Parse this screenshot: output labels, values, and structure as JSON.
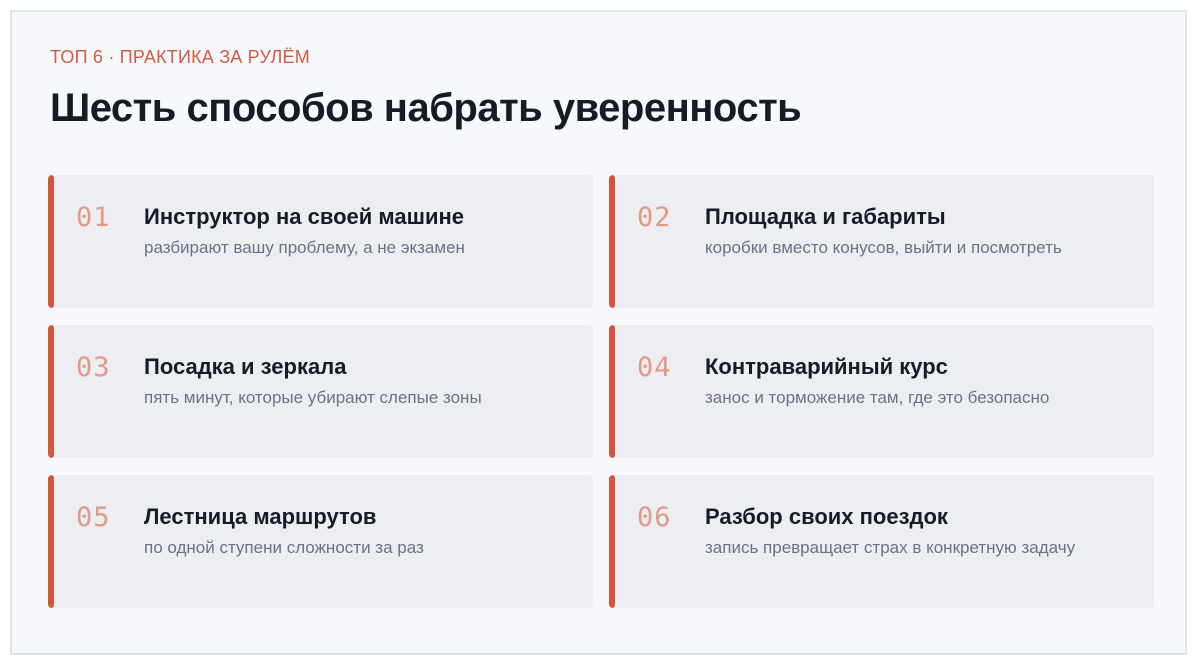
{
  "header": {
    "kicker": "ТОП 6 · ПРАКТИКА ЗА РУЛЁМ",
    "title": "Шесть способов набрать уверенность"
  },
  "colors": {
    "accent": "#d4553a",
    "number": "#e29a86",
    "card_bg": "#eceef2",
    "page_bg": "#f7f8fb",
    "title": "#171b24",
    "subtitle": "#6b7382"
  },
  "items": [
    {
      "number": "01",
      "title": "Инструктор на своей машине",
      "subtitle": "разбирают вашу проблему, а не экзамен"
    },
    {
      "number": "02",
      "title": "Площадка и габариты",
      "subtitle": "коробки вместо конусов, выйти и посмотреть"
    },
    {
      "number": "03",
      "title": "Посадка и зеркала",
      "subtitle": "пять минут, которые убирают слепые зоны"
    },
    {
      "number": "04",
      "title": "Контраварийный курс",
      "subtitle": "занос и торможение там, где это безопасно"
    },
    {
      "number": "05",
      "title": "Лестница маршрутов",
      "subtitle": "по одной ступени сложности за раз"
    },
    {
      "number": "06",
      "title": "Разбор своих поездок",
      "subtitle": "запись превращает страх в конкретную задачу"
    }
  ]
}
